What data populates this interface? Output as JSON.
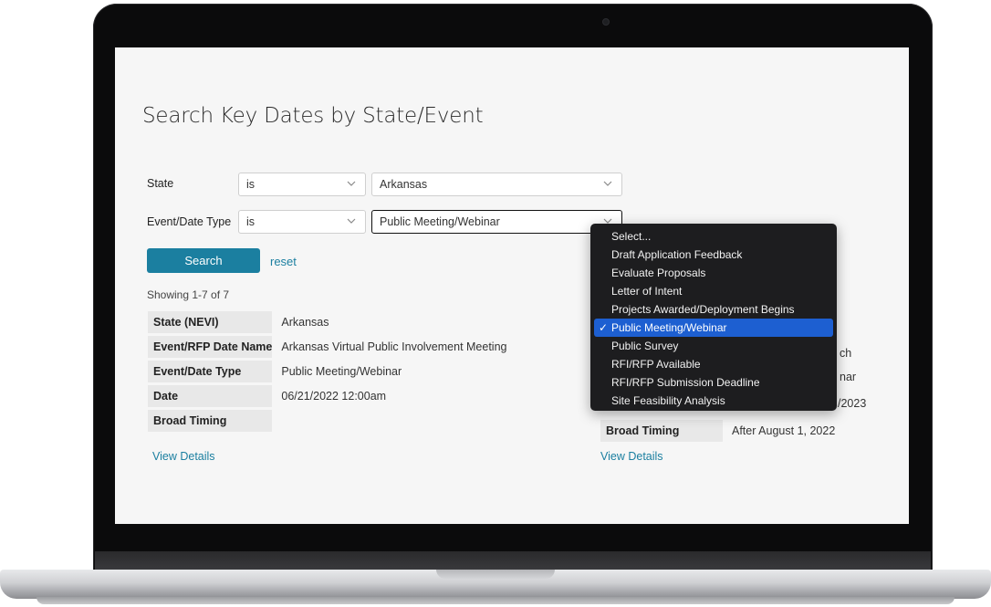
{
  "page": {
    "title": "Search Key Dates by State/Event"
  },
  "filters": {
    "state": {
      "label": "State",
      "operator": "is",
      "value": "Arkansas"
    },
    "event_type": {
      "label": "Event/Date Type",
      "operator": "is",
      "value": "Public Meeting/Webinar"
    }
  },
  "actions": {
    "search_label": "Search",
    "reset_label": "reset"
  },
  "results": {
    "showing": "Showing 1-7 of 7",
    "keys": [
      "State (NEVI)",
      "Event/RFP Date Name",
      "Event/Date Type",
      "Date",
      "Broad Timing"
    ],
    "left_record": {
      "values": [
        "Arkansas",
        "Arkansas Virtual Public Involvement Meeting",
        "Public Meeting/Webinar",
        "06/21/2022 12:00am",
        ""
      ],
      "view_label": "View Details"
    },
    "right_record": {
      "visible_fragments": [
        "ch",
        "nar",
        "/2023"
      ],
      "broad_timing_key": "Broad Timing",
      "broad_timing_value": "After August 1, 2022",
      "view_label": "View Details"
    }
  },
  "dropdown": {
    "options": [
      "Select...",
      "Draft Application Feedback",
      "Evaluate Proposals",
      "Letter of Intent",
      "Projects Awarded/Deployment Begins",
      "Public Meeting/Webinar",
      "Public Survey",
      "RFI/RFP Available",
      "RFI/RFP Submission Deadline",
      "Site Feasibility Analysis"
    ],
    "selected": "Public Meeting/Webinar",
    "check_glyph": "✓"
  },
  "colors": {
    "accent": "#1b7fa0",
    "dropdown_bg": "#1d1d1f",
    "dropdown_selected": "#1d5fd1",
    "table_key_bg": "#e8e8e8"
  }
}
